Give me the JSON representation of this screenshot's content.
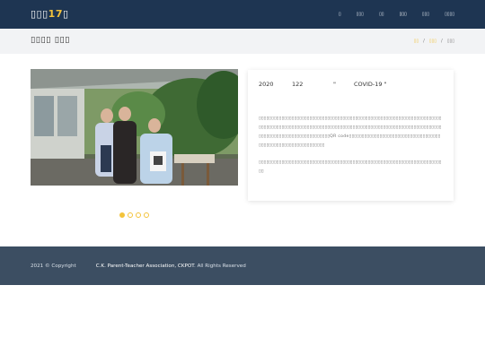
{
  "header": {
    "brand_white": "▯▯▯",
    "brand_number": "17",
    "brand_tail": "▯",
    "nav": [
      "▯",
      "▯▯▯",
      "▯▯",
      "▯▯▯",
      "▯▯▯",
      "▯▯▯▯"
    ],
    "active_nav_index": 3
  },
  "title_bar": {
    "title": "▯▯▯▯ ▯▯▯",
    "breadcrumb": [
      "▯▯",
      "▯▯▯",
      "▯▯▯"
    ],
    "separator": "/"
  },
  "carousel": {
    "slide_count": 4,
    "active_index": 0
  },
  "card": {
    "year": "2020",
    "number": "122",
    "quote_mark": "\"",
    "topic": "COVID-19 \"",
    "paragraph1": "▯▯▯▯▯▯▯▯▯▯▯▯▯▯▯▯▯▯▯▯▯▯▯▯▯▯▯▯▯▯▯▯▯▯▯▯▯▯▯▯▯▯▯▯▯▯▯▯▯▯▯▯▯▯▯▯▯▯▯▯▯▯▯▯▯▯▯▯▯▯▯▯▯▯▯▯▯▯▯▯▯▯▯▯▯▯▯▯▯▯▯▯▯▯▯▯▯▯▯▯▯▯▯▯▯▯▯▯▯▯▯▯▯▯▯▯▯▯▯▯▯▯▯▯▯▯▯▯▯▯▯▯▯▯▯▯▯▯▯▯▯▯▯▯▯▯▯▯▯▯▯▯▯▯▯▯▯▯▯▯▯▯▯▯▯▯▯▯▯▯▯▯QR code▯▯▯▯▯▯▯▯▯▯▯▯▯▯▯▯▯▯▯▯▯▯▯▯▯▯▯▯▯▯▯▯▯▯▯▯▯▯▯▯▯▯▯▯▯▯▯▯▯▯▯▯▯▯▯▯▯▯▯▯▯▯",
    "paragraph2": "▯▯▯▯▯▯▯▯▯▯▯▯▯▯▯▯▯▯▯▯▯▯▯▯▯▯▯▯▯▯▯▯▯▯▯▯▯▯▯▯▯▯▯▯▯▯▯▯▯▯▯▯▯▯▯▯▯▯▯▯▯▯▯▯▯▯▯▯▯▯▯▯▯▯"
  },
  "footer": {
    "copyright": "2021 © Copyright",
    "org": "C.K. Parent-Teacher Association, CKPOT",
    "rights": ". All Rights Reserved"
  },
  "colors": {
    "navbar_bg": "#1e3552",
    "accent": "#f3c33b",
    "title_bar_bg": "#f2f3f5",
    "footer_bg": "#3c4e62"
  },
  "icons": [
    "carousel-dot-icon"
  ]
}
